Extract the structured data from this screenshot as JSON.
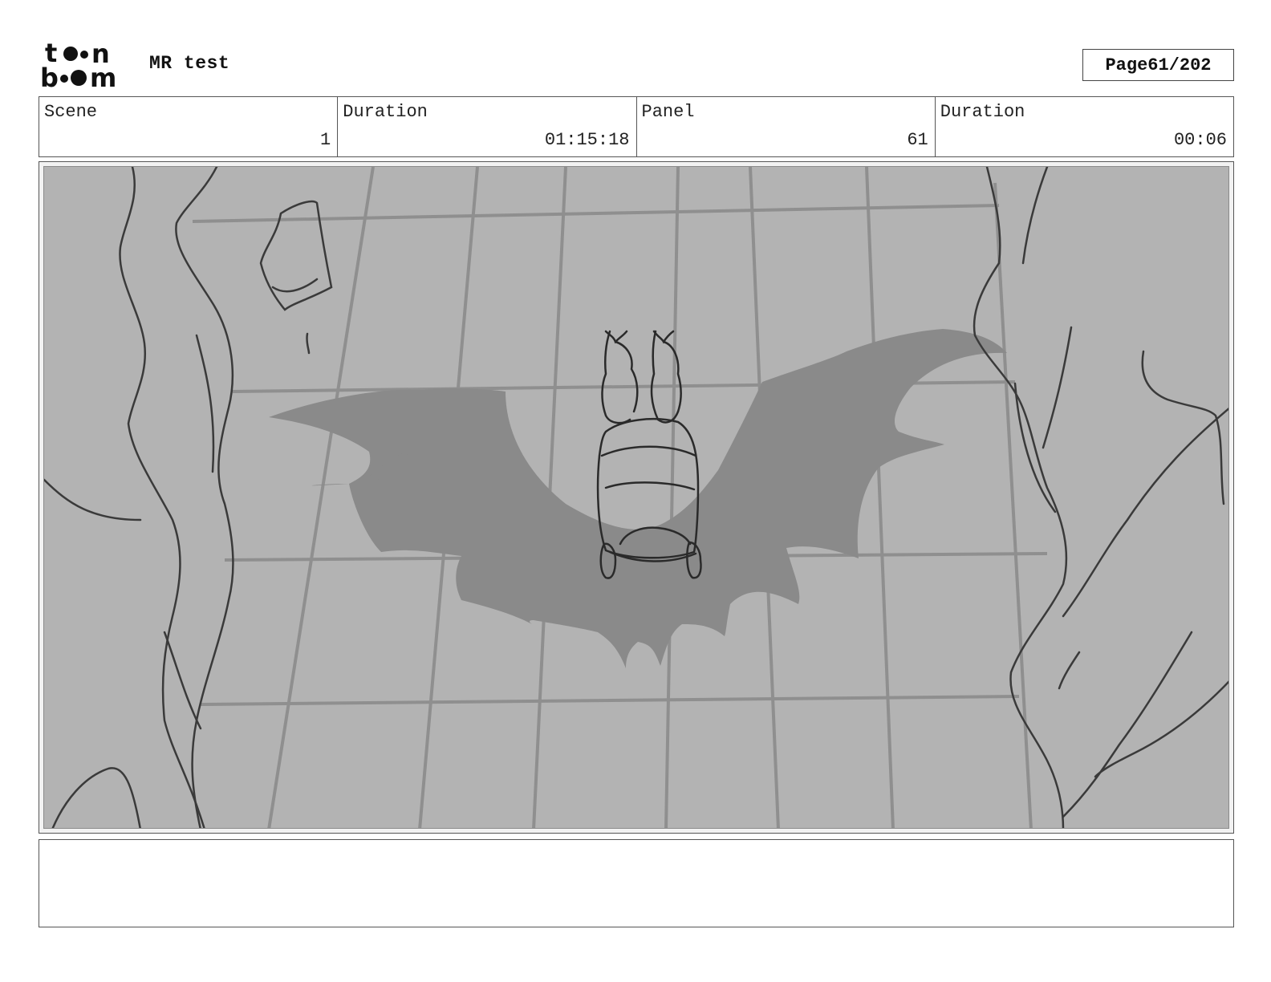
{
  "header": {
    "logo_text_top": "to•n",
    "logo_text_bottom": "b••m",
    "project_title": "MR test",
    "page_label": "Page",
    "page_number": "61/202"
  },
  "info": {
    "scene_label": "Scene",
    "scene_value": "1",
    "scene_duration_label": "Duration",
    "scene_duration_value": "01:15:18",
    "panel_label": "Panel",
    "panel_value": "61",
    "panel_duration_label": "Duration",
    "panel_duration_value": "00:06"
  },
  "notes": {
    "text": ""
  }
}
